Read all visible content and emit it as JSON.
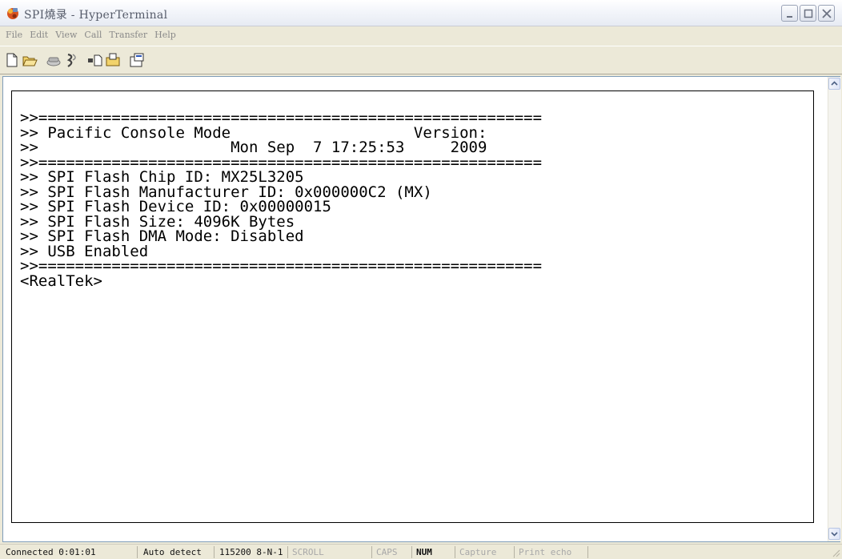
{
  "window": {
    "title": "SPI燒录 - HyperTerminal",
    "app_icon": "hyperterminal-icon",
    "controls": [
      "minimize-icon",
      "maximize-icon",
      "close-icon"
    ]
  },
  "menu": [
    "File",
    "Edit",
    "View",
    "Call",
    "Transfer",
    "Help"
  ],
  "toolbar": {
    "buttons": [
      "new-connection-icon",
      "open-icon",
      "disconnect-icon",
      "call-icon",
      "send-icon",
      "receive-icon",
      "properties-icon"
    ]
  },
  "terminal": {
    "lines": [
      ">>=======================================================",
      ">> Pacific Console Mode                    Version:",
      ">>                     Mon Sep  7 17:25:53     2009",
      ">>=======================================================",
      ">> SPI Flash Chip ID: MX25L3205",
      ">> SPI Flash Manufacturer ID: 0x000000C2 (MX)",
      ">> SPI Flash Device ID: 0x00000015",
      ">> SPI Flash Size: 4096K Bytes",
      ">> SPI Flash DMA Mode: Disabled",
      ">> USB Enabled",
      ">>=======================================================",
      "<RealTek>"
    ]
  },
  "statusbar": {
    "connected": "Connected 0:01:01",
    "detect": "Auto detect",
    "settings": "115200 8-N-1",
    "scroll": "SCROLL",
    "caps": "CAPS",
    "num": "NUM",
    "capture": "Capture",
    "print_echo": "Print echo"
  }
}
